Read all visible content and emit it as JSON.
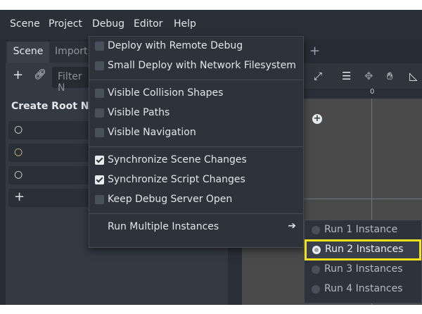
{
  "menubar": {
    "items": [
      "Scene",
      "Project",
      "Debug",
      "Editor",
      "Help"
    ]
  },
  "dock": {
    "tabs": [
      "Scene",
      "Import"
    ],
    "filter_placeholder": "Filter N",
    "create_root_title": "Create Root Nod"
  },
  "debug_menu": {
    "items": [
      {
        "label": "Deploy with Remote Debug",
        "checked": false
      },
      {
        "label": "Small Deploy with Network Filesystem",
        "checked": false
      },
      {
        "label": "Visible Collision Shapes",
        "checked": false
      },
      {
        "label": "Visible Paths",
        "checked": false
      },
      {
        "label": "Visible Navigation",
        "checked": false
      },
      {
        "label": "Synchronize Scene Changes",
        "checked": true
      },
      {
        "label": "Synchronize Script Changes",
        "checked": true
      },
      {
        "label": "Keep Debug Server Open",
        "checked": false
      },
      {
        "label": "Run Multiple Instances",
        "submenu": true
      }
    ]
  },
  "instances_submenu": {
    "items": [
      {
        "label": "Run 1 Instance",
        "selected": false
      },
      {
        "label": "Run 2 Instances",
        "selected": true
      },
      {
        "label": "Run 3 Instances",
        "selected": false
      },
      {
        "label": "Run 4 Instances",
        "selected": false
      }
    ]
  },
  "viewport": {
    "ruler_zero": "0"
  },
  "colors": {
    "highlight_outline": "#f2e11b",
    "menu_bg": "#2d323b",
    "viewport_bg": "#4a4a4a"
  }
}
